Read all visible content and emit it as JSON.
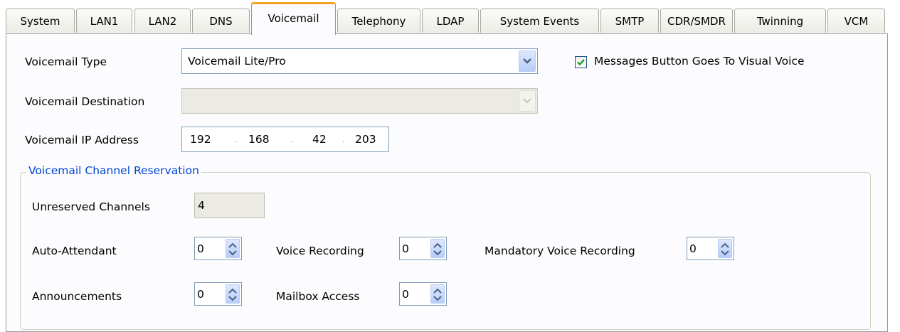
{
  "tabs": [
    {
      "label": "System"
    },
    {
      "label": "LAN1"
    },
    {
      "label": "LAN2"
    },
    {
      "label": "DNS"
    },
    {
      "label": "Voicemail",
      "active": true
    },
    {
      "label": "Telephony"
    },
    {
      "label": "LDAP"
    },
    {
      "label": "System Events"
    },
    {
      "label": "SMTP"
    },
    {
      "label": "CDR/SMDR"
    },
    {
      "label": "Twinning"
    },
    {
      "label": "VCM"
    }
  ],
  "voicemail": {
    "type_label": "Voicemail Type",
    "type_value": "Voicemail Lite/Pro",
    "visual_voice_label": "Messages Button Goes To Visual Voice",
    "visual_voice_checked": true,
    "destination_label": "Voicemail Destination",
    "destination_value": "",
    "ip_label": "Voicemail IP Address",
    "ip": [
      "192",
      "168",
      "42",
      "203"
    ]
  },
  "reservation": {
    "title": "Voicemail Channel Reservation",
    "unreserved_label": "Unreserved Channels",
    "unreserved_value": "4",
    "auto_attendant_label": "Auto-Attendant",
    "auto_attendant_value": "0",
    "voice_recording_label": "Voice Recording",
    "voice_recording_value": "0",
    "mandatory_label": "Mandatory Voice Recording",
    "mandatory_value": "0",
    "announcements_label": "Announcements",
    "announcements_value": "0",
    "mailbox_label": "Mailbox Access",
    "mailbox_value": "0"
  },
  "colors": {
    "active_tab_accent": "#f2a227",
    "group_title": "#0046d5",
    "check_mark": "#21a121"
  }
}
